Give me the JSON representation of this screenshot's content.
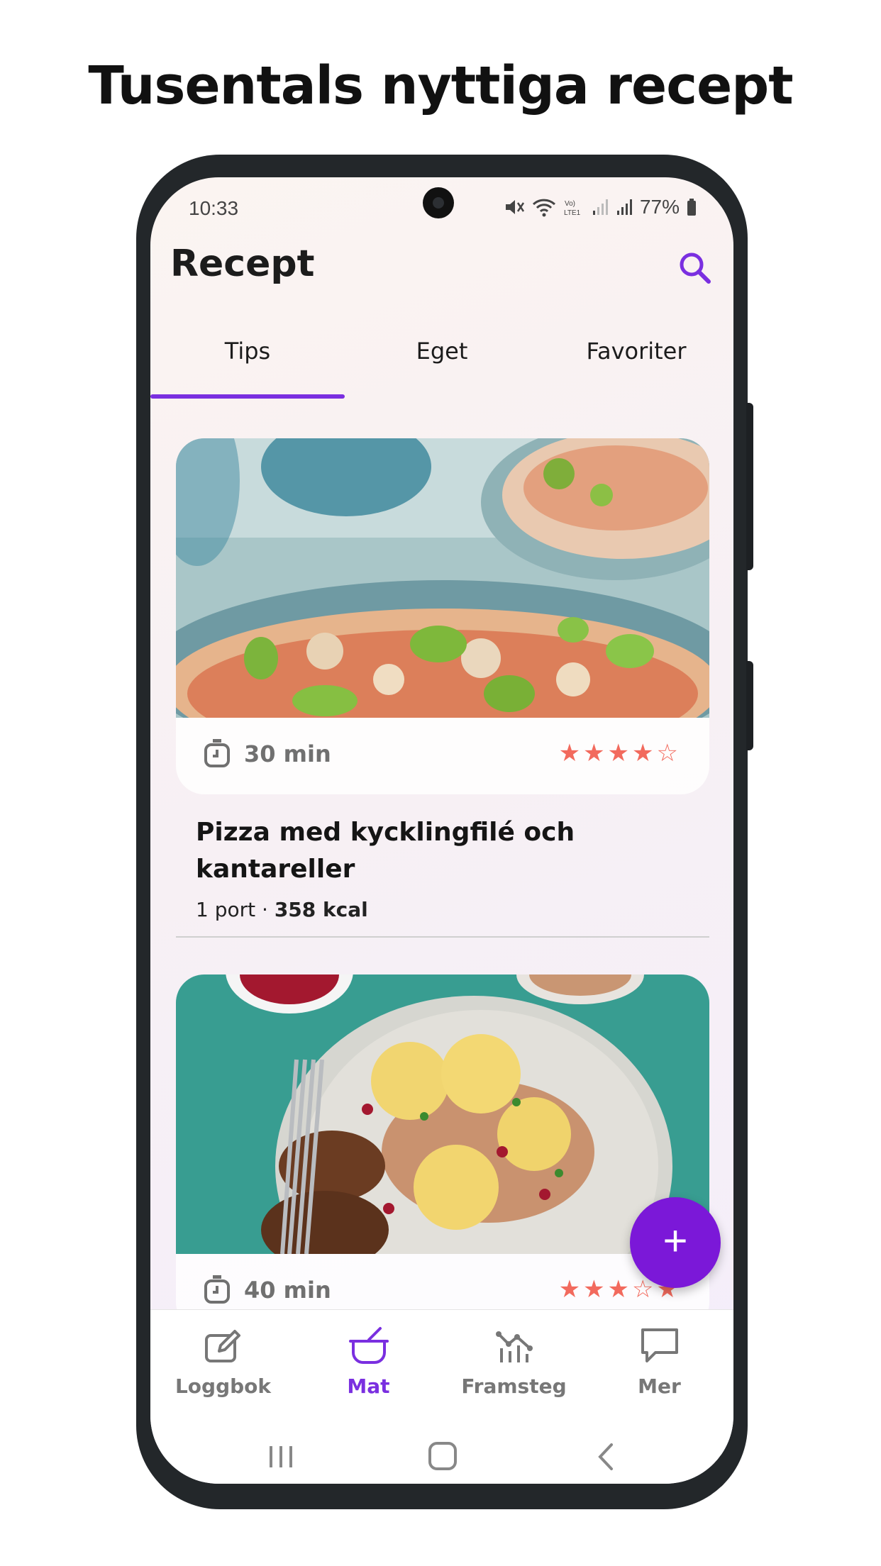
{
  "headline": "Tusentals nyttiga recept",
  "status_bar": {
    "time": "10:33",
    "battery": "77%"
  },
  "screen": {
    "title": "Recept",
    "search_icon": "search-icon"
  },
  "tabs": [
    {
      "label": "Tips",
      "active": true
    },
    {
      "label": "Eget",
      "active": false
    },
    {
      "label": "Favoriter",
      "active": false
    }
  ],
  "recipes": [
    {
      "time": "30 min",
      "rating": 4,
      "rating_max": 5,
      "name": "Pizza med kycklingfilé och kantareller",
      "portions": "1 port",
      "kcal": "358 kcal"
    },
    {
      "time": "40 min",
      "rating": 3.5,
      "rating_max": 5
    }
  ],
  "fab": {
    "label": "+"
  },
  "bottom_nav": [
    {
      "label": "Loggbok",
      "icon": "edit-icon",
      "active": false
    },
    {
      "label": "Mat",
      "icon": "pot-icon",
      "active": true
    },
    {
      "label": "Framsteg",
      "icon": "chart-icon",
      "active": false
    },
    {
      "label": "Mer",
      "icon": "chat-icon",
      "active": false
    }
  ],
  "colors": {
    "accent": "#7a2fe0",
    "fab": "#7b18d8",
    "star": "#f26a5d"
  }
}
